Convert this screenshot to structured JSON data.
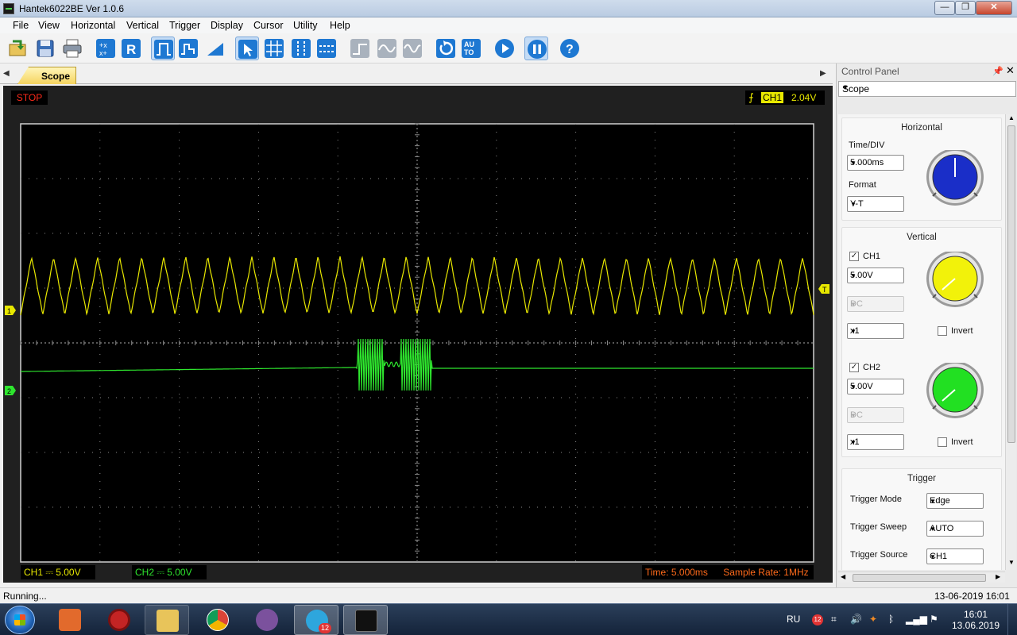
{
  "window": {
    "title": "Hantek6022BE Ver 1.0.6",
    "min": "—",
    "max": "❐",
    "close": "✕"
  },
  "menu": [
    "File",
    "View",
    "Horizontal",
    "Vertical",
    "Trigger",
    "Display",
    "Cursor",
    "Utility",
    "Help"
  ],
  "toolbar": {
    "icons": [
      "open-icon",
      "save-icon",
      "print-icon",
      "auto-set-icon",
      "reset-icon",
      "square-wave-icon",
      "pulse-icon",
      "ramp-icon",
      "cursor-select-icon",
      "grid-icon",
      "vertical-cursor-icon",
      "horizontal-cursor-icon",
      "step-icon",
      "sine-icon",
      "wave-icon",
      "refresh-icon",
      "auto-icon",
      "run-icon",
      "pause-icon",
      "help-icon"
    ],
    "reset_label": "R",
    "auto_label": "AU TO",
    "help_label": "?"
  },
  "scope": {
    "tab": "Scope",
    "status": "STOP",
    "trigger": {
      "channel": "CH1",
      "level": "2.04V",
      "edge_glyph": "⨍"
    },
    "ch1_marker": "1",
    "ch2_marker": "2",
    "trig_marker": "T",
    "bottom": {
      "ch1": "CH1 ⎓  5.00V",
      "ch2": "CH2 ⎓  5.00V",
      "time": "Time: 5.000ms",
      "sample_rate": "Sample Rate: 1MHz"
    },
    "colors": {
      "ch1": "#e8e800",
      "ch2": "#2ee62e",
      "grid": "#8a8a8a",
      "background": "#000000"
    }
  },
  "control_panel": {
    "title": "Control Panel",
    "pin": "🖈",
    "close": "✕",
    "mode": "Scope",
    "horizontal": {
      "title": "Horizontal",
      "time_div_label": "Time/DIV",
      "time_div": "5.000ms",
      "format_label": "Format",
      "format": "Y-T",
      "knob_color": "#1a2ec8"
    },
    "vertical": {
      "title": "Vertical",
      "ch1": {
        "label": "CH1",
        "checked": "✓",
        "volts": "5.00V",
        "coupling": "DC",
        "probe": "x1",
        "invert_label": "Invert",
        "knob_color": "#f2f20a"
      },
      "ch2": {
        "label": "CH2",
        "checked": "✓",
        "volts": "5.00V",
        "coupling": "DC",
        "probe": "x1",
        "invert_label": "Invert",
        "knob_color": "#22e022"
      }
    },
    "trigger": {
      "title": "Trigger",
      "mode_label": "Trigger Mode",
      "mode": "Edge",
      "sweep_label": "Trigger Sweep",
      "sweep": "AUTO",
      "source_label": "Trigger Source",
      "source": "CH1"
    }
  },
  "status": {
    "text": "Running...",
    "datetime": "13-06-2019 16:01"
  },
  "taskbar": {
    "lang": "RU",
    "time": "16:01",
    "date": "13.06.2019",
    "telegram_badge": "12",
    "tray_badge": "12"
  }
}
